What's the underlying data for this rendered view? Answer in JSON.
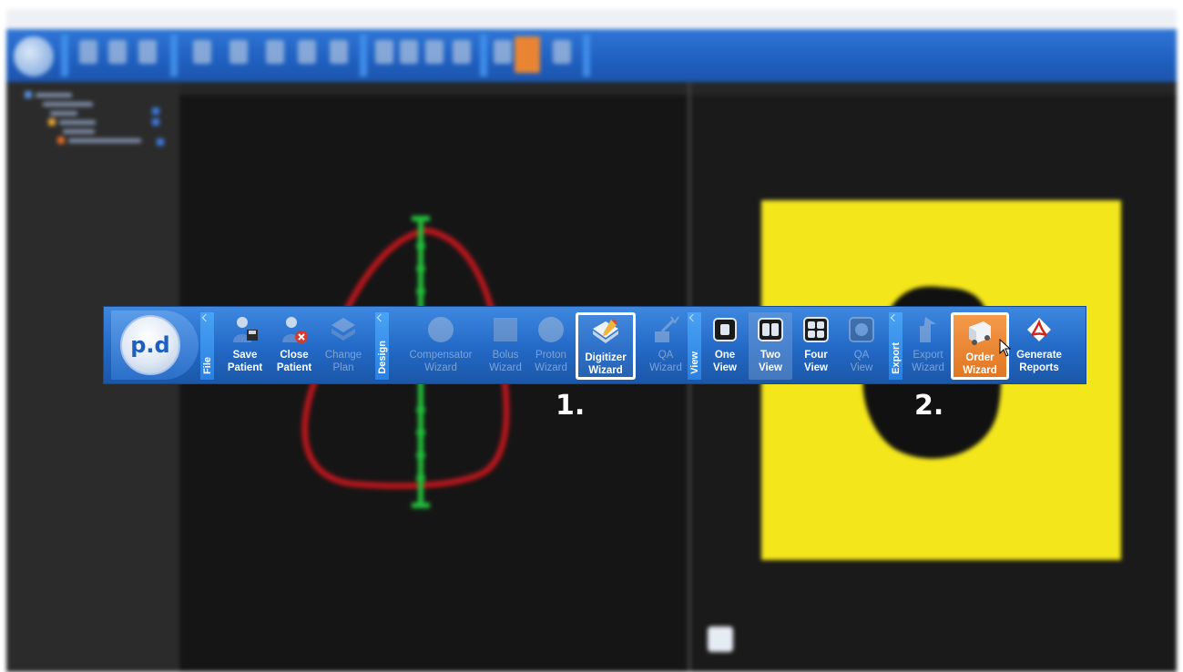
{
  "ribbon": {
    "logo_text": "p.d",
    "groups": {
      "file": "File",
      "design": "Design",
      "view": "View",
      "export": "Export"
    },
    "buttons": {
      "save_patient": [
        "Save",
        "Patient"
      ],
      "close_patient": [
        "Close",
        "Patient"
      ],
      "change_plan": [
        "Change",
        "Plan"
      ],
      "compensator_wizard": [
        "Compensator",
        "Wizard"
      ],
      "bolus_wizard": [
        "Bolus",
        "Wizard"
      ],
      "proton_wizard": [
        "Proton",
        "Wizard"
      ],
      "digitizer_wizard": [
        "Digitizer",
        "Wizard"
      ],
      "qa_wizard": [
        "QA",
        "Wizard"
      ],
      "one_view": [
        "One",
        "View"
      ],
      "two_view": [
        "Two",
        "View"
      ],
      "four_view": [
        "Four",
        "View"
      ],
      "qa_view": [
        "QA",
        "View"
      ],
      "export_wizard": [
        "Export",
        "Wizard"
      ],
      "order_wizard": [
        "Order",
        "Wizard"
      ],
      "generate_reports": [
        "Generate",
        "Reports"
      ]
    }
  },
  "annotations": {
    "step1": "1.",
    "step2": "2."
  },
  "colors": {
    "ribbon_blue": "#2369c6",
    "order_orange": "#e17722",
    "contour_red": "#b3161c",
    "axis_green": "#22c03a",
    "field_yellow": "#f3e61b"
  }
}
